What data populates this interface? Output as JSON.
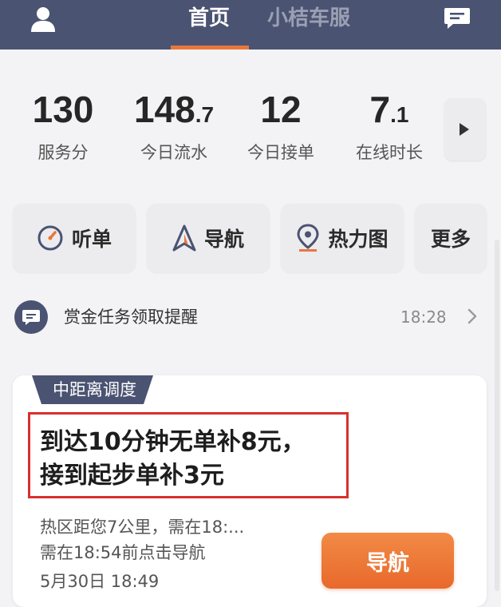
{
  "header": {
    "tabs": [
      {
        "label": "首页",
        "active": true
      },
      {
        "label": "小桔车服",
        "active": false
      }
    ],
    "icons": {
      "left": "user-icon",
      "right": "message-icon"
    },
    "colors": {
      "background": "#4b5372",
      "accent": "#e8773d"
    }
  },
  "stats": [
    {
      "value": "130",
      "fraction": "",
      "label": "服务分"
    },
    {
      "value": "148",
      "fraction": ".7",
      "label": "今日流水"
    },
    {
      "value": "12",
      "fraction": "",
      "label": "今日接单"
    },
    {
      "value": "7",
      "fraction": ".1",
      "label": "在线时长"
    }
  ],
  "actions": [
    {
      "label": "听单",
      "icon": "gauge-icon"
    },
    {
      "label": "导航",
      "icon": "navigation-arrow-icon"
    },
    {
      "label": "热力图",
      "icon": "location-pin-icon"
    },
    {
      "label": "更多",
      "icon": ""
    }
  ],
  "notice": {
    "text": "赏金任务领取提醒",
    "time": "18:28",
    "icon": "chat-bubble-icon"
  },
  "card": {
    "tag": "中距离调度",
    "title_line1": "到达10分钟无单补8元，",
    "title_line2": "接到起步单补3元",
    "detail_line1": "热区距您7公里，需在18:...",
    "detail_line2": "需在18:54前点击导航",
    "detail_line3": "5月30日 18:49",
    "nav_button": "导航",
    "colors": {
      "highlight_border": "#d9302d",
      "button": "#e8692b",
      "tag": "#4b5372"
    }
  }
}
